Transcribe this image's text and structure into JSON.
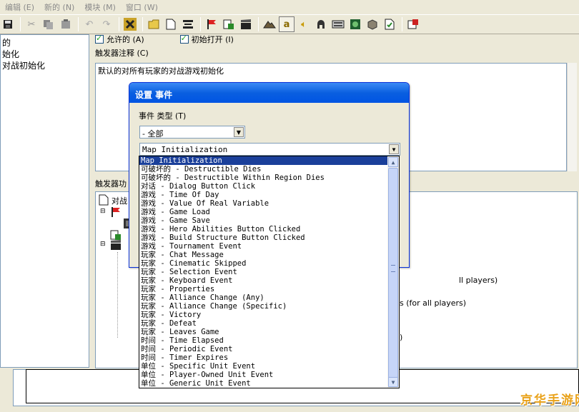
{
  "menu": {
    "items": [
      "编辑 (E)",
      "新的 (N)",
      "模块 (M)",
      "窗口 (W)"
    ]
  },
  "toolbar": {
    "icons": [
      "save-icon",
      "cut-icon",
      "copy-icon",
      "paste-icon",
      "undo-icon",
      "redo-icon",
      "close-x-icon",
      "folder-icon",
      "new-doc-icon",
      "list-icon",
      "flag-icon",
      "script-icon",
      "clapper-icon",
      "terrain-icon",
      "unit-a-icon",
      "sound-icon",
      "helmet-icon",
      "keyboard-icon",
      "monster-icon",
      "box-icon",
      "doc-check-icon",
      "test-map-icon"
    ]
  },
  "left_tree": {
    "items": [
      "的",
      "始化",
      "对战初始化"
    ]
  },
  "trigger": {
    "enabled_label": "允许的 (A)",
    "initially_on_label": "初始打开 (I)",
    "comment_label": "触发器注释 (C)",
    "comment_text": "默认的对所有玩家的对战游戏初始化",
    "functions_label": "触发器功",
    "func_root": "对战",
    "func_partial_1": "ll players)",
    "func_partial_2": "ns (for all players)",
    "func_partial_3": ")"
  },
  "dialog": {
    "title": "设置 事件",
    "type_label": "事件 类型 (T)",
    "filter_value": "- 全部",
    "selected_event": "Map Initialization"
  },
  "event_list": {
    "items": [
      "Map Initialization",
      "可破坏的 - Destructible Dies",
      "可破坏的 - Destructible Within Region Dies",
      "对话 - Dialog Button Click",
      "游戏 - Time Of Day",
      "游戏 - Value Of Real Variable",
      "游戏 - Game Load",
      "游戏 - Game Save",
      "游戏 - Hero Abilities Button Clicked",
      "游戏 - Build Structure Button Clicked",
      "游戏 - Tournament Event",
      "玩家 - Chat Message",
      "玩家 - Cinematic Skipped",
      "玩家 - Selection Event",
      "玩家 - Keyboard Event",
      "玩家 - Properties",
      "玩家 - Alliance Change (Any)",
      "玩家 - Alliance Change (Specific)",
      "玩家 - Victory",
      "玩家 - Defeat",
      "玩家 - Leaves Game",
      "时间 - Time Elapsed",
      "时间 - Periodic Event",
      "时间 - Timer Expires",
      "单位 - Specific Unit Event",
      "单位 - Player-Owned Unit Event",
      "单位 - Generic Unit Event"
    ],
    "selected_index": 0
  },
  "watermark": "京华手游网"
}
